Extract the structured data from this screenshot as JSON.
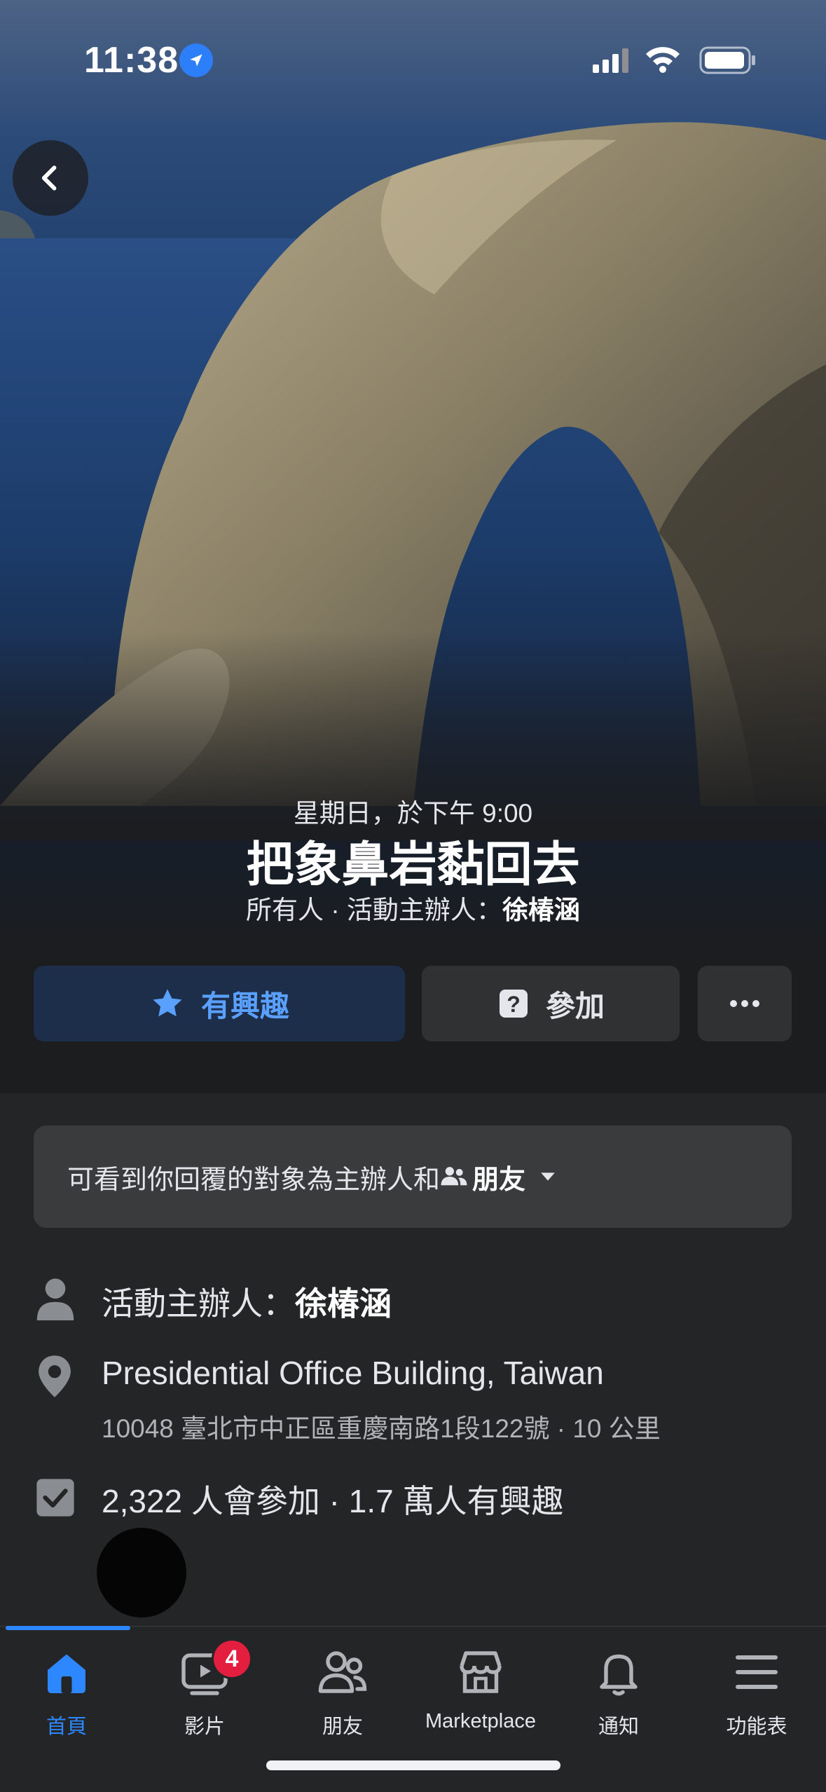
{
  "status_bar": {
    "time": "11:38"
  },
  "event": {
    "date": "星期日，於下午 9:00",
    "title": "把象鼻岩黏回去",
    "audience": "所有人 · 活動主辦人：",
    "host_name": "徐椿涵"
  },
  "actions": {
    "interested_label": "有興趣",
    "join_label": "參加",
    "more_label": "···"
  },
  "privacy": {
    "text": "可看到你回覆的對象為主辦人和",
    "audience_label": "朋友"
  },
  "details": {
    "host_prefix": "活動主辦人：",
    "host_name": "徐椿涵",
    "location_name": "Presidential Office Building, Taiwan",
    "location_address": "10048 臺北市中正區重慶南路1段122號 · 10 公里",
    "attendance": "2,322 人會參加 · 1.7 萬人有興趣"
  },
  "tabbar": {
    "items": [
      {
        "label": "首頁",
        "icon": "home-icon",
        "active": true
      },
      {
        "label": "影片",
        "icon": "video-icon",
        "badge": "4"
      },
      {
        "label": "朋友",
        "icon": "friends-icon"
      },
      {
        "label": "Marketplace",
        "icon": "marketplace-icon"
      },
      {
        "label": "通知",
        "icon": "bell-icon"
      },
      {
        "label": "功能表",
        "icon": "menu-icon"
      }
    ]
  },
  "colors": {
    "accent": "#2d88ff",
    "badge": "#e41e3f",
    "background": "#242526"
  }
}
